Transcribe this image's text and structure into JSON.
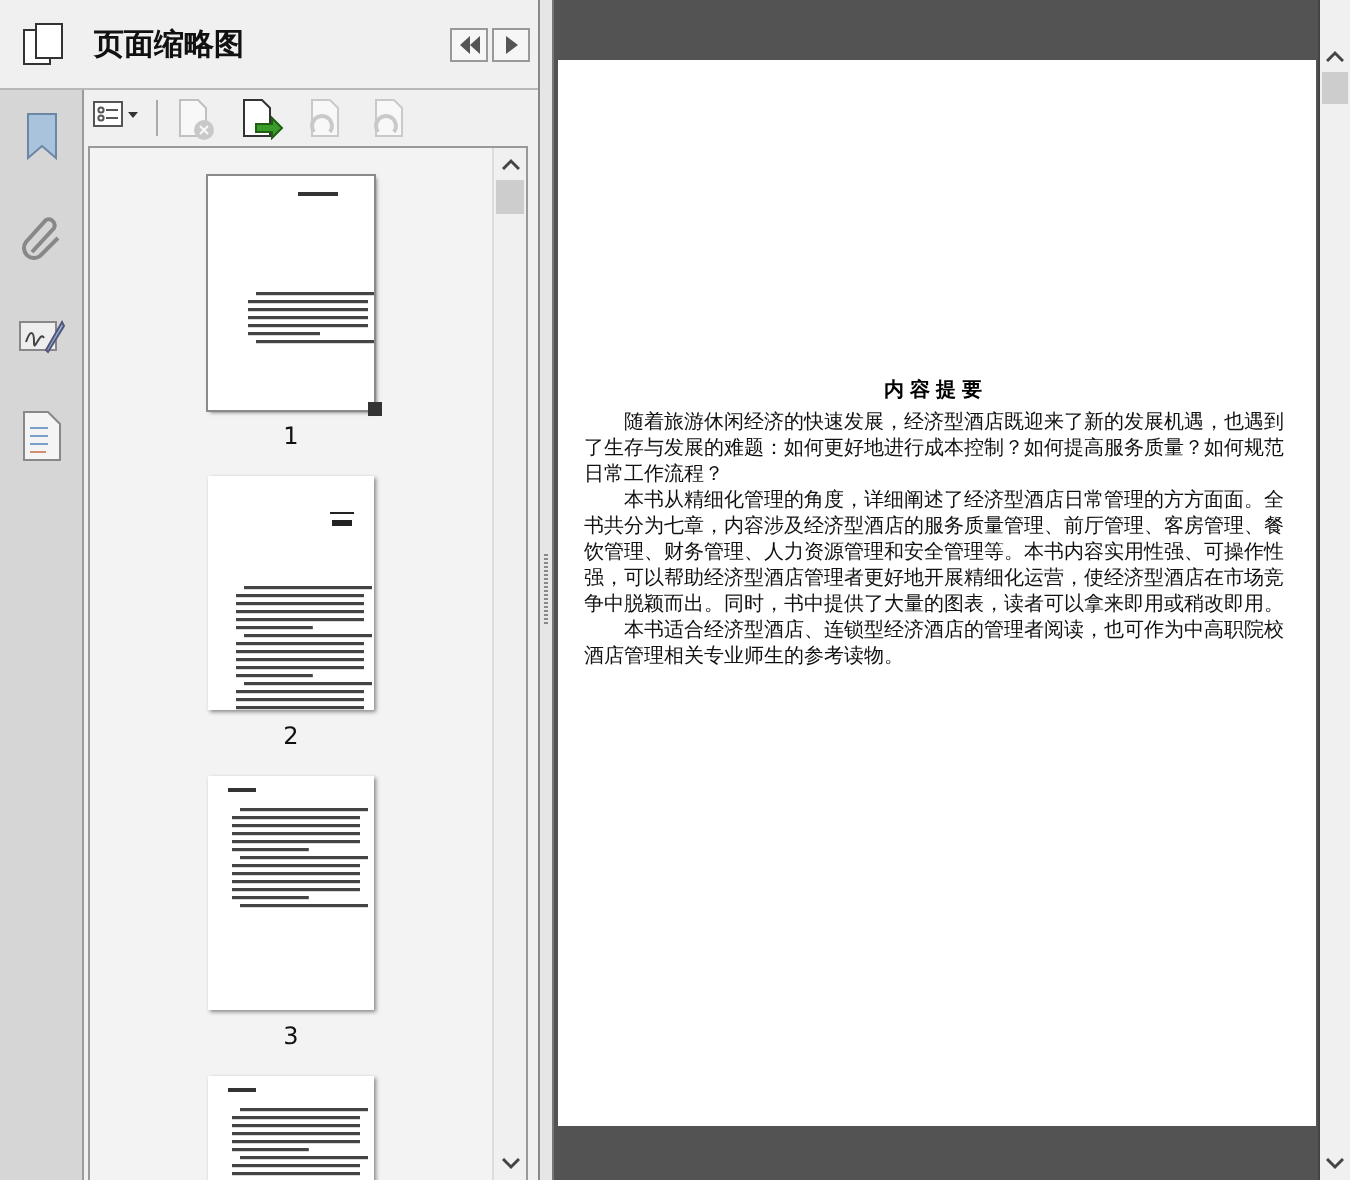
{
  "panel": {
    "title": "页面缩略图"
  },
  "toolbar": [
    {
      "kind": "options",
      "disabled": false
    },
    {
      "kind": "delete",
      "disabled": true
    },
    {
      "kind": "insert",
      "disabled": false
    },
    {
      "kind": "undo",
      "disabled": true
    },
    {
      "kind": "redo",
      "disabled": true
    }
  ],
  "thumbnails": [
    {
      "label": "1",
      "selected": true
    },
    {
      "label": "2",
      "selected": false
    },
    {
      "label": "3",
      "selected": false
    },
    {
      "selected": false
    }
  ],
  "document": {
    "heading": "内容提要",
    "paragraphs": [
      "随着旅游休闲经济的快速发展，经济型酒店既迎来了新的发展机遇，也遇到了生存与发展的难题：如何更好地进行成本控制？如何提高服务质量？如何规范日常工作流程？",
      "本书从精细化管理的角度，详细阐述了经济型酒店日常管理的方方面面。全书共分为七章，内容涉及经济型酒店的服务质量管理、前厅管理、客房管理、餐饮管理、财务管理、人力资源管理和安全管理等。本书内容实用性强、可操作性强，可以帮助经济型酒店管理者更好地开展精细化运营，使经济型酒店在市场竞争中脱颖而出。同时，书中提供了大量的图表，读者可以拿来即用或稍改即用。",
      "本书适合经济型酒店、连锁型经济酒店的管理者阅读，也可作为中高职院校酒店管理相关专业师生的参考读物。"
    ]
  }
}
